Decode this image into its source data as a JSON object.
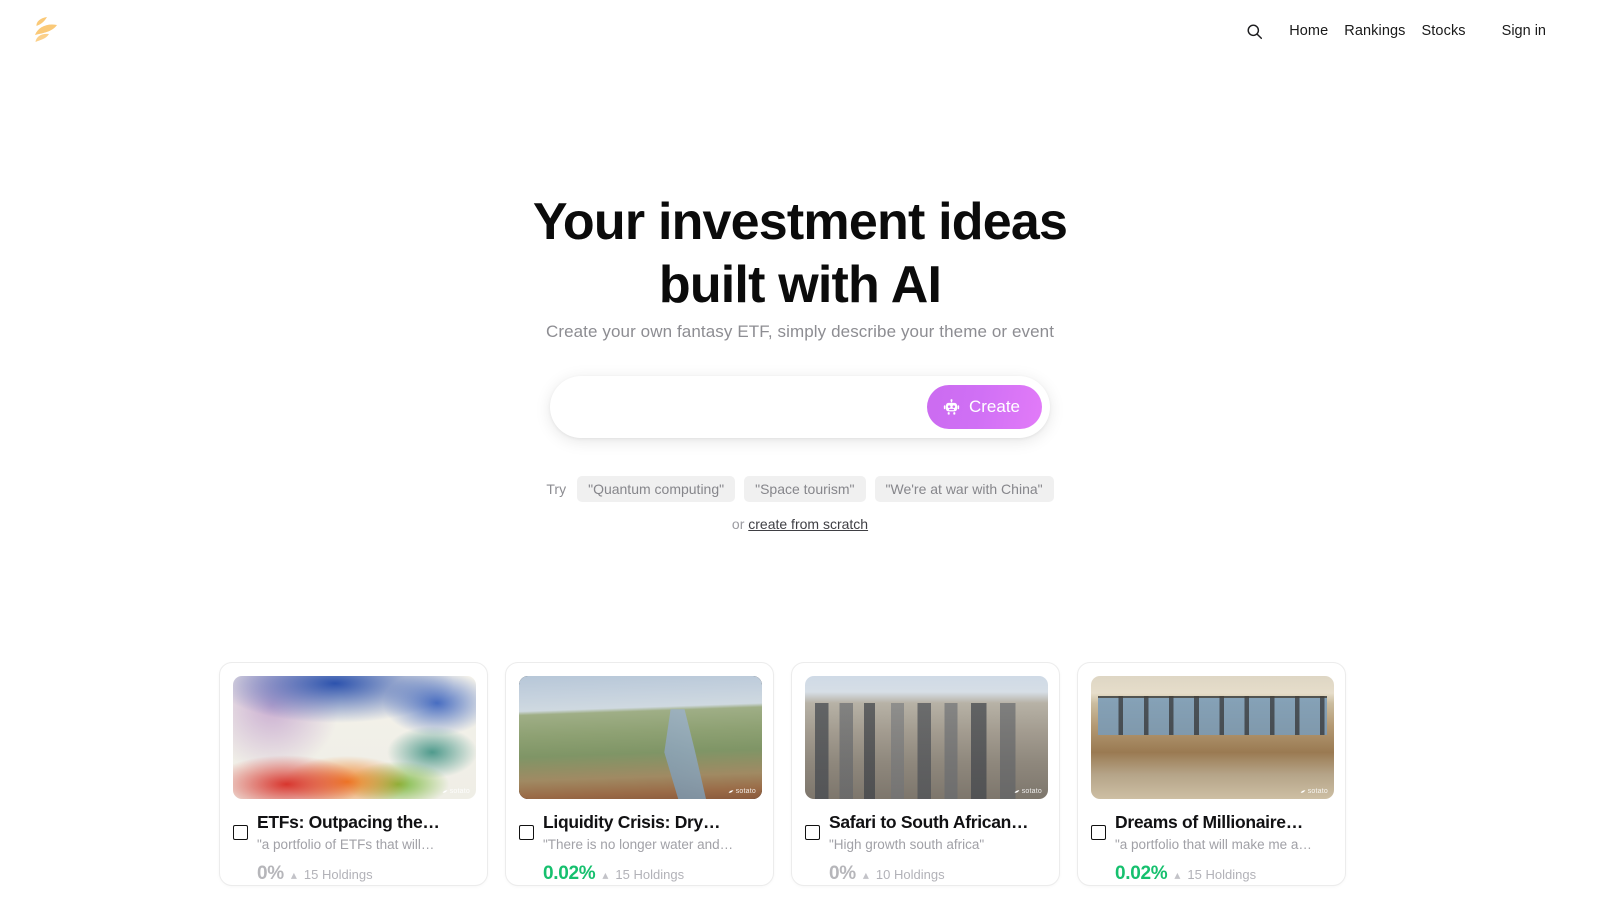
{
  "nav": {
    "logo_name": "logo-leaf-mark",
    "search_icon": "search-icon",
    "links": [
      {
        "label": "Home"
      },
      {
        "label": "Rankings"
      },
      {
        "label": "Stocks"
      }
    ],
    "signin_label": "Sign in"
  },
  "hero": {
    "headline_line1": "Your investment ideas",
    "headline_line2": "built with AI",
    "subtitle": "Create your own fantasy ETF, simply describe your theme or event"
  },
  "search": {
    "value": "",
    "placeholder": "",
    "create_label": "Create",
    "create_icon": "robot-icon",
    "create_color": "#d070f5"
  },
  "suggestions": {
    "try_label": "Try",
    "chips": [
      {
        "label": "\"Quantum computing\""
      },
      {
        "label": "\"Space tourism\""
      },
      {
        "label": "\"We're at war with China\""
      }
    ],
    "or_label": "or",
    "scratch_link": "create from scratch"
  },
  "cards": [
    {
      "title": "ETFs: Outpacing the…",
      "subtitle": "\"a portfolio of ETFs that will…",
      "percent": "0%",
      "percent_state": "neutral",
      "arrow": "▴",
      "holdings": "15 Holdings",
      "image_name": "abstract-paint-splash-image",
      "watermark": "sotato"
    },
    {
      "title": "Liquidity Crisis: Dry…",
      "subtitle": "\"There is no longer water and…",
      "percent": "0.02%",
      "percent_state": "up",
      "arrow": "▴",
      "holdings": "15 Holdings",
      "image_name": "dry-river-landscape-image",
      "watermark": "sotato"
    },
    {
      "title": "Safari to South African…",
      "subtitle": "\"High growth south africa\"",
      "percent": "0%",
      "percent_state": "neutral",
      "arrow": "▴",
      "holdings": "10 Holdings",
      "image_name": "city-skyline-aerial-image",
      "watermark": "sotato"
    },
    {
      "title": "Dreams of Millionaire…",
      "subtitle": "\"a portfolio that will make me a…",
      "percent": "0.02%",
      "percent_state": "up",
      "arrow": "▴",
      "holdings": "15 Holdings",
      "image_name": "trading-floor-office-image",
      "watermark": "sotato"
    }
  ],
  "colors": {
    "accent_purple": "#d070f5",
    "logo_yellow": "#f9c765",
    "up_green": "#16c06e",
    "neutral_gray": "#b6b6ba"
  }
}
